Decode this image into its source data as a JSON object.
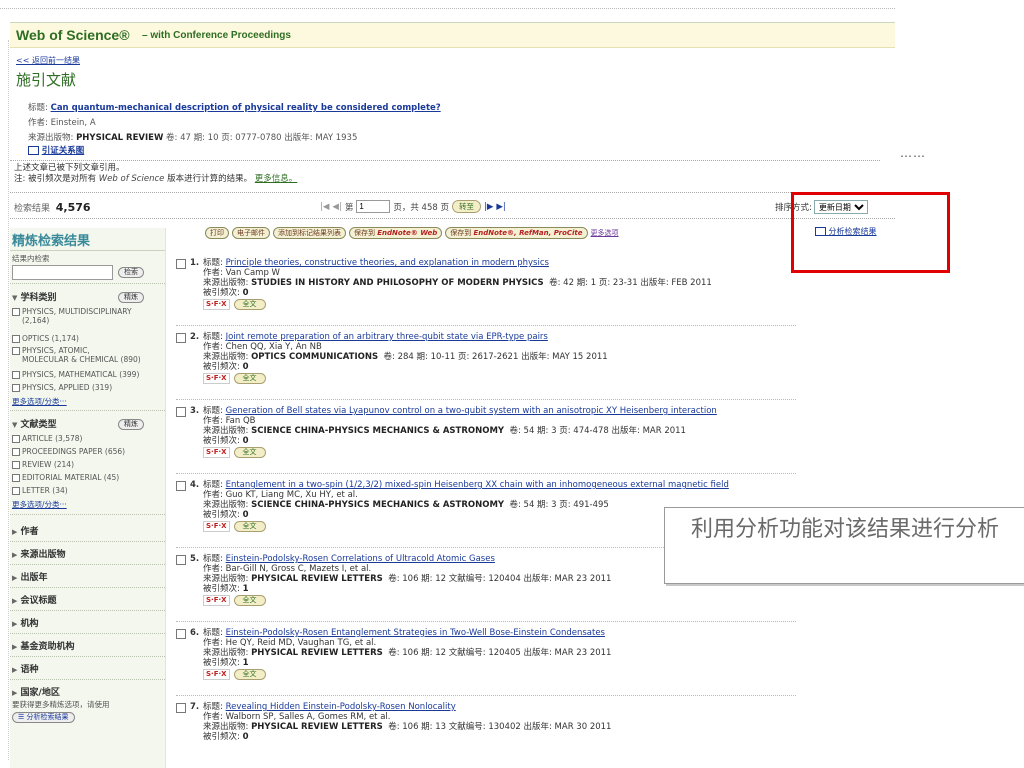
{
  "header": {
    "logo": "Web of Science®",
    "subtitle": "– with Conference Proceedings"
  },
  "back_link": "<< 返回前一结果",
  "page_title": "施引文献",
  "record": {
    "title_label": "标题:",
    "title": "Can quantum-mechanical description of physical reality be considered complete?",
    "author_label": "作者:",
    "author": "Einstein, A",
    "source_label": "来源出版物:",
    "source": "PHYSICAL REVIEW",
    "source_detail": "卷: 47 期: 10 页: 0777-0780 出版年: MAY 1935",
    "citation_map": "引证关系图"
  },
  "notice": {
    "line1": "上述文章已被下列文章引用。",
    "line2_prefix": "注: 被引频次是对所有",
    "line2_italic": "Web of Science",
    "line2_suffix": "版本进行计算的结果。",
    "more_info": "更多信息。"
  },
  "results_bar": {
    "label": "检索结果",
    "count": "4,576",
    "page_prefix": "第",
    "page_value": "1",
    "page_suffix": "页，共 458 页",
    "go_button": "转至",
    "sort_label": "排序方式:",
    "sort_value": "更新日期"
  },
  "toolbar": {
    "print": "打印",
    "email": "电子邮件",
    "add_marked": "添加到标记结果列表",
    "save_endnote_web": "保存到",
    "endnote_web": "EndNote® Web",
    "save_endnote": "保存到",
    "endnote_refman": "EndNote®, RefMan, ProCite",
    "more": "更多选项",
    "analyze": "分析检索结果"
  },
  "sidebar": {
    "title": "精炼检索结果",
    "within_label": "结果内检索",
    "search_button": "检索",
    "refine_button": "精炼",
    "subject": {
      "title": "学科类别",
      "items": [
        {
          "label": "PHYSICS, MULTIDISCIPLINARY",
          "count": "(2,164)"
        },
        {
          "label": "OPTICS (1,174)"
        },
        {
          "label": "PHYSICS, ATOMIC,",
          "count": "MOLECULAR & CHEMICAL (890)"
        },
        {
          "label": "PHYSICS, MATHEMATICAL (399)"
        },
        {
          "label": "PHYSICS, APPLIED (319)"
        }
      ],
      "more": "更多选项/分类···"
    },
    "doctype": {
      "title": "文献类型",
      "items": [
        {
          "label": "ARTICLE (3,578)"
        },
        {
          "label": "PROCEEDINGS PAPER (656)"
        },
        {
          "label": "REVIEW (214)"
        },
        {
          "label": "EDITORIAL MATERIAL (45)"
        },
        {
          "label": "LETTER (34)"
        }
      ],
      "more": "更多选项/分类···"
    },
    "collapsed": [
      "作者",
      "来源出版物",
      "出版年",
      "会议标题",
      "机构",
      "基金资助机构",
      "语种",
      "国家/地区"
    ],
    "footer_text": "要获得更多精炼选项，请使用",
    "footer_button": "分析检索结果"
  },
  "labels": {
    "title": "标题:",
    "author": "作者:",
    "source": "来源出版物:",
    "cited": "被引频次:",
    "fulltext": "全文",
    "sfx": "S·F·X"
  },
  "results": [
    {
      "num": "1.",
      "title": "Principle theories, constructive theories, and explanation in modern physics",
      "authors": "Van Camp W",
      "journal": "STUDIES IN HISTORY AND PHILOSOPHY OF MODERN PHYSICS",
      "detail": "卷: 42  期: 1  页: 23-31  出版年: FEB 2011",
      "cited": "0"
    },
    {
      "num": "2.",
      "title": "Joint remote preparation of an arbitrary three-qubit state via EPR-type pairs",
      "authors": "Chen QQ, Xia Y, An NB",
      "journal": "OPTICS COMMUNICATIONS",
      "detail": "卷: 284  期: 10-11  页: 2617-2621  出版年: MAY 15 2011",
      "cited": "0"
    },
    {
      "num": "3.",
      "title": "Generation of Bell states via Lyapunov control on a two-qubit system with an anisotropic XY Heisenberg interaction",
      "authors": "Fan QB",
      "journal": "SCIENCE CHINA-PHYSICS MECHANICS & ASTRONOMY",
      "detail": "卷: 54  期: 3  页: 474-478  出版年: MAR 2011",
      "cited": "0"
    },
    {
      "num": "4.",
      "title": "Entanglement in a two-spin (1/2,3/2) mixed-spin Heisenberg XX chain with an inhomogeneous external magnetic field",
      "authors": "Guo KT, Liang MC, Xu HY, et al.",
      "journal": "SCIENCE CHINA-PHYSICS MECHANICS & ASTRONOMY",
      "detail": "卷: 54  期: 3  页: 491-495",
      "cited": "0"
    },
    {
      "num": "5.",
      "title": "Einstein-Podolsky-Rosen Correlations of Ultracold Atomic Gases",
      "authors": "Bar-Gill N, Gross C, Mazets I, et al.",
      "journal": "PHYSICAL REVIEW LETTERS",
      "detail": "卷: 106  期: 12 文献编号: 120404  出版年: MAR 23 2011",
      "cited": "1"
    },
    {
      "num": "6.",
      "title": "Einstein-Podolsky-Rosen Entanglement Strategies in Two-Well Bose-Einstein Condensates",
      "authors": "He QY, Reid MD, Vaughan TG, et al.",
      "journal": "PHYSICAL REVIEW LETTERS",
      "detail": "卷: 106  期: 12 文献编号: 120405  出版年: MAR 23 2011",
      "cited": "1"
    },
    {
      "num": "7.",
      "title": "Revealing Hidden Einstein-Podolsky-Rosen Nonlocality",
      "authors": "Walborn SP, Salles A, Gomes RM, et al.",
      "journal": "PHYSICAL REVIEW LETTERS",
      "detail": "卷: 106  期: 13 文献编号: 130402  出版年: MAR 30 2011",
      "cited": "0"
    }
  ],
  "callout": "利用分析功能对该结果进行分析",
  "ellipsis": "……",
  "colors": {
    "brand_green": "#2e6e23",
    "link_blue": "#1a3a9a",
    "highlight_red": "#e00000",
    "header_bg": "#fdf9de"
  }
}
